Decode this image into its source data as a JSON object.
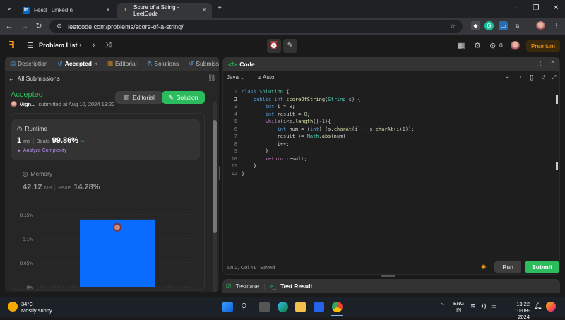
{
  "browser": {
    "tabs": [
      {
        "title": "Feed | LinkedIn",
        "favicon": "in"
      },
      {
        "title": "Score of a String - LeetCode",
        "favicon": "L"
      }
    ],
    "url": "leetcode.com/problems/score-of-a-string/"
  },
  "header": {
    "problem_list": "Problem List",
    "coins": "0",
    "premium": "Premium"
  },
  "left": {
    "tabs": [
      "Description",
      "Accepted",
      "Editorial",
      "Solutions",
      "Submissio"
    ],
    "all_submissions": "All Submissions",
    "status": "Accepted",
    "author": "Vign...",
    "submitted": "submitted at Aug 10, 2024 13:22",
    "editorial_btn": "Editorial",
    "solution_btn": "Solution",
    "runtime_label": "Runtime",
    "runtime_value": "1",
    "runtime_unit": "ms",
    "runtime_beats_label": "Beats",
    "runtime_beats": "99.86%",
    "analyze": "Analyze Complexity",
    "memory_label": "Memory",
    "memory_value": "42.12",
    "memory_unit": "MB",
    "memory_beats_label": "Beats",
    "memory_beats": "14.28%"
  },
  "chart_data": {
    "type": "bar",
    "y_ticks": [
      "0.15%",
      "0.1%",
      "0.05%",
      "0%"
    ],
    "ylim": [
      0,
      0.15
    ],
    "values": [
      0.14
    ],
    "bar_color": "#0a6cff"
  },
  "editor": {
    "title": "Code",
    "language": "Java",
    "mode": "Auto",
    "lines": [
      "class Solution {",
      "    public int scoreOfString(String s) {",
      "        int i = 0;",
      "        int result = 0;",
      "        while(i<s.length()-1){",
      "            int num = (int) (s.charAt(i) - s.charAt(i+1));",
      "            result += Math.abs(num);",
      "            i++;",
      "        }",
      "        return result;",
      "    }",
      "}"
    ],
    "cursor": "Ln 2, Col 41",
    "saved": "Saved",
    "run": "Run",
    "submit": "Submit"
  },
  "test": {
    "testcase": "Testcase",
    "result": "Test Result"
  },
  "taskbar": {
    "temp": "34°C",
    "weather": "Mostly sunny",
    "lang1": "ENG",
    "lang2": "IN",
    "time": "13:22",
    "date": "10-08-2024"
  },
  "colors": {
    "accent_green": "#2cbb5d",
    "premium_orange": "#ffa116",
    "bar_blue": "#0a6cff"
  }
}
